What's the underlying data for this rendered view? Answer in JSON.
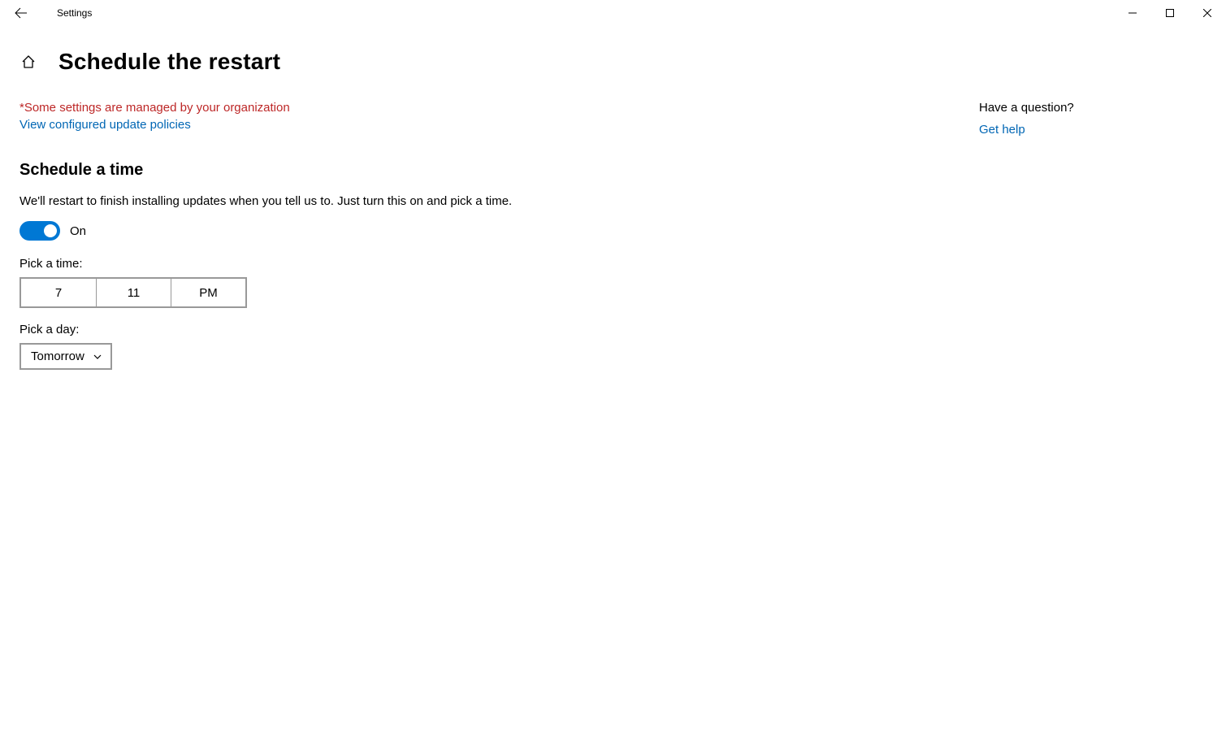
{
  "titlebar": {
    "app_name": "Settings"
  },
  "header": {
    "title": "Schedule the restart"
  },
  "notice": {
    "org_text": "*Some settings are managed by your organization",
    "policies_link": "View configured update policies"
  },
  "section": {
    "title": "Schedule a time",
    "description": "We'll restart to finish installing updates when you tell us to. Just turn this on and pick a time.",
    "toggle_state_label": "On"
  },
  "time": {
    "label": "Pick a time:",
    "hour": "7",
    "minute": "11",
    "ampm": "PM"
  },
  "day": {
    "label": "Pick a day:",
    "value": "Tomorrow"
  },
  "aside": {
    "heading": "Have a question?",
    "help_link": "Get help"
  }
}
